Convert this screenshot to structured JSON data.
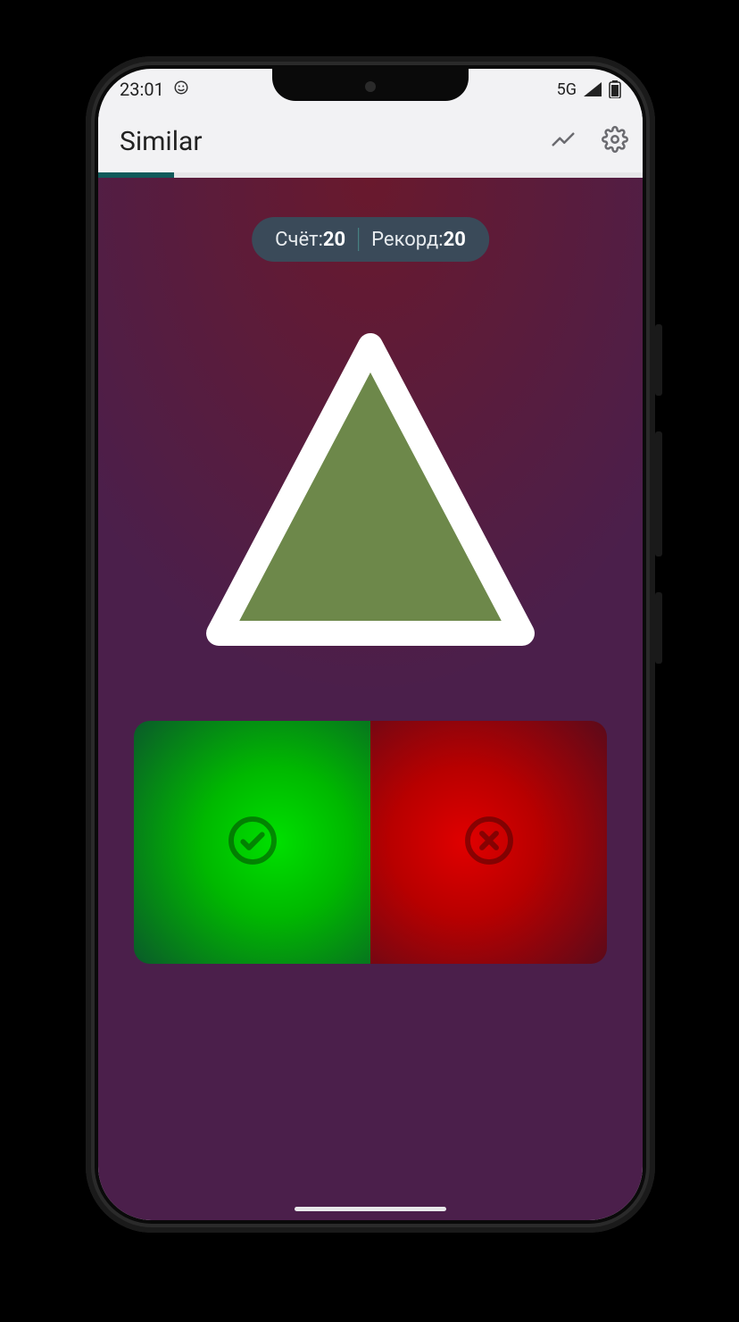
{
  "statusbar": {
    "time": "23:01",
    "network_label": "5G"
  },
  "appbar": {
    "title": "Similar"
  },
  "progress": {
    "percent": 14
  },
  "score": {
    "score_label": "Счёт:",
    "score_value": "20",
    "record_label": "Рекорд:",
    "record_value": "20"
  },
  "shape": {
    "kind": "triangle",
    "fill": "#6d884a",
    "stroke": "#ffffff"
  },
  "colors": {
    "yes": "#00c800",
    "no": "#c80000",
    "pill_bg": "#3a4a59",
    "play_bg": "#4b1f4b",
    "progress_fill": "#0f5a5a"
  }
}
